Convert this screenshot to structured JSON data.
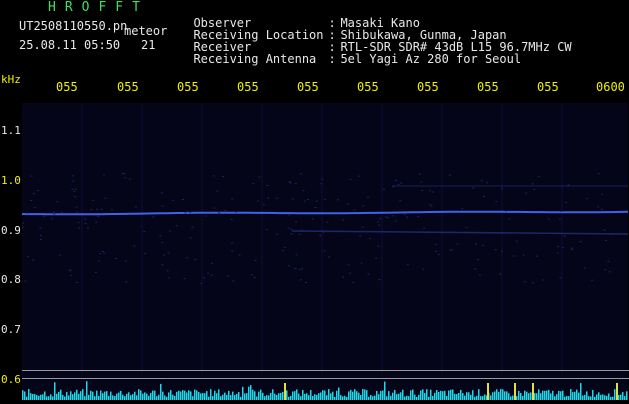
{
  "header": {
    "title": "HROFFT",
    "filename": "UT2508110550.pn",
    "meteor_label": "meteor",
    "datetime": "25.08.11 05:50",
    "count": "21"
  },
  "info": [
    {
      "key": "Observer",
      "value": "Masaki Kano"
    },
    {
      "key": "Receiving Location",
      "value": "Shibukawa, Gunma, Japan"
    },
    {
      "key": "Receiver",
      "value": "RTL-SDR SDR# 43dB L15 96.7MHz CW"
    },
    {
      "key": "Receiving Antenna",
      "value": "5el Yagi Az 280 for Seoul"
    }
  ],
  "axis": {
    "unit": "kHz",
    "y_ticks": [
      "1.1",
      "1.0",
      "0.9",
      "0.8",
      "0.7",
      "0.6"
    ],
    "x_ticks": [
      "055",
      "055",
      "055",
      "055",
      "055",
      "055",
      "055",
      "055",
      "055",
      "0600"
    ]
  },
  "colors": {
    "header_green": "#3ee05a",
    "label_yellow": "#f0f000",
    "trace_blue": "#4a6cff",
    "noise_cyan": "#22d8e8"
  }
}
